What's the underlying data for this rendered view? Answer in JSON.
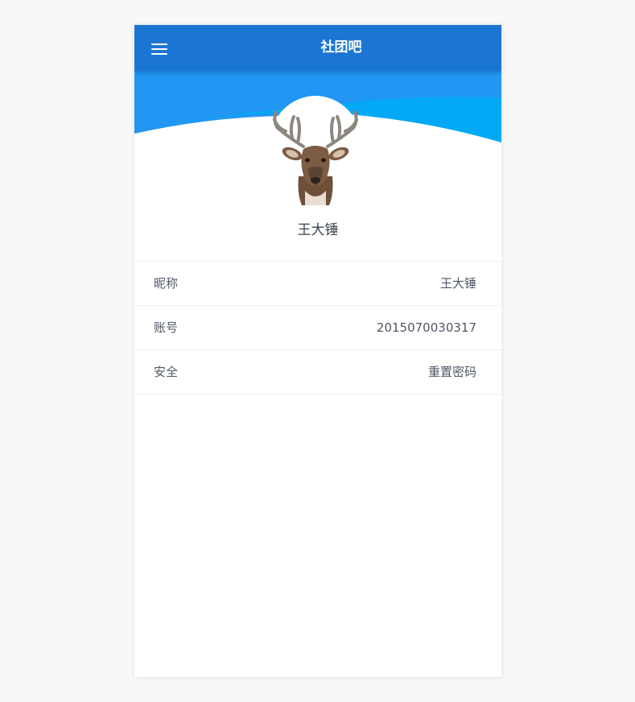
{
  "app_bar": {
    "title": "社团吧",
    "menu_icon": "menu-icon",
    "background": "#1b76d3"
  },
  "header": {
    "colors": [
      "#2196f3",
      "#03a9f4"
    ]
  },
  "profile": {
    "avatar_icon": "deer-avatar",
    "name": "王大锤"
  },
  "info_list": [
    {
      "label": "昵称",
      "value": "王大锤"
    },
    {
      "label": "账号",
      "value": "2015070030317"
    },
    {
      "label": "安全",
      "value": "重置密码"
    }
  ]
}
